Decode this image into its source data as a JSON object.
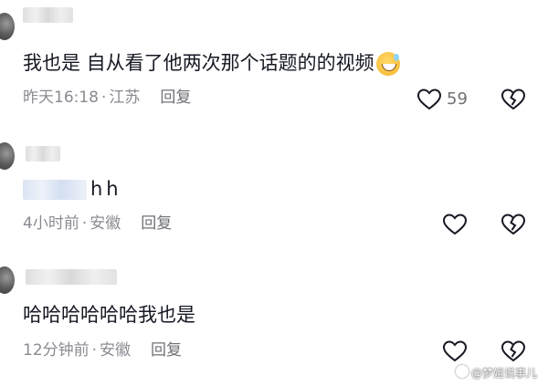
{
  "comments": [
    {
      "text": "我也是 自从看了他两次那个话题的的视频",
      "emoji": "grinning-sweat-emoji",
      "time": "昨天16:18",
      "location": "江苏",
      "reply_label": "回复",
      "like_count": "59"
    },
    {
      "text": "hh",
      "time": "4小时前",
      "location": "安徽",
      "reply_label": "回复"
    },
    {
      "text": "哈哈哈哈哈哈我也是",
      "time": "12分钟前",
      "location": "安徽",
      "reply_label": "回复"
    }
  ],
  "separator": "·",
  "icons": {
    "like": "heart-outline-icon",
    "dislike": "broken-heart-icon"
  },
  "watermark": "@梦姐说事儿",
  "colors": {
    "text": "#161823",
    "meta": "#8a8b91",
    "icon": "#161823",
    "background": "#ffffff"
  }
}
